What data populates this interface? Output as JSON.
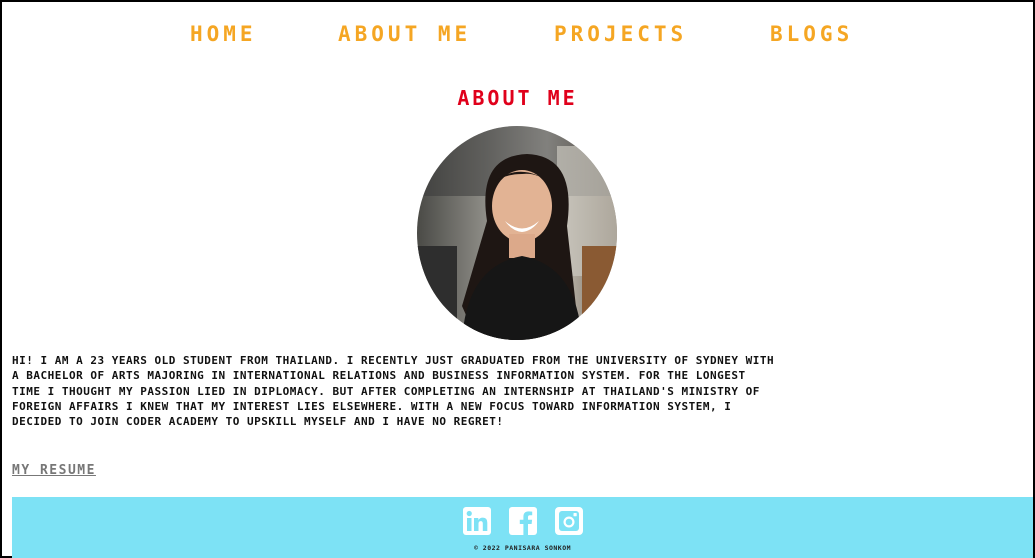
{
  "nav": {
    "items": [
      {
        "label": "HOME"
      },
      {
        "label": "ABOUT ME"
      },
      {
        "label": "PROJECTS"
      },
      {
        "label": "BLOGS"
      }
    ]
  },
  "page": {
    "title": "ABOUT ME"
  },
  "bio": {
    "lines": [
      "HI! I AM A 23 YEARS OLD STUDENT FROM THAILAND. I RECENTLY JUST GRADUATED FROM THE UNIVERSITY OF SYDNEY WITH",
      "A BACHELOR OF ARTS MAJORING IN INTERNATIONAL RELATIONS AND BUSINESS INFORMATION SYSTEM. FOR THE LONGEST",
      "TIME I THOUGHT MY PASSION LIED IN DIPLOMACY. BUT AFTER COMPLETING AN INTERNSHIP AT THAILAND'S MINISTRY OF",
      "FOREIGN AFFAIRS I KNEW THAT MY INTEREST LIES ELSEWHERE. WITH A NEW FOCUS TOWARD INFORMATION SYSTEM, I",
      "DECIDED TO JOIN CODER ACADEMY TO UPSKILL MYSELF AND I HAVE NO REGRET!"
    ]
  },
  "resume": {
    "label": "MY RESUME"
  },
  "footer": {
    "icons": [
      "linkedin-icon",
      "facebook-icon",
      "instagram-icon"
    ],
    "copyright": "© 2022 PANISARA SONKOM"
  },
  "colors": {
    "nav": "#F5A623",
    "title": "#E0001B",
    "footer_bg": "#7DE2F5",
    "text": "#111111",
    "resume": "#777777"
  }
}
